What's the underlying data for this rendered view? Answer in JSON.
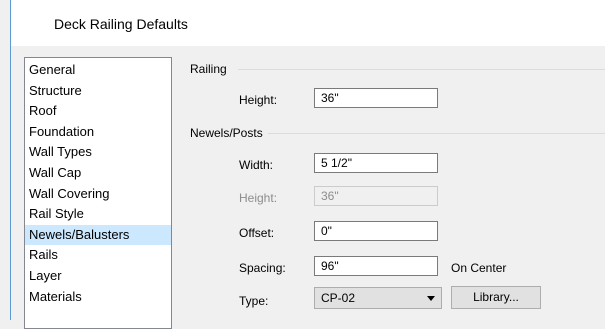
{
  "window": {
    "title": "Deck Railing Defaults"
  },
  "sidebar": {
    "items": [
      {
        "label": "General",
        "selected": false
      },
      {
        "label": "Structure",
        "selected": false
      },
      {
        "label": "Roof",
        "selected": false
      },
      {
        "label": "Foundation",
        "selected": false
      },
      {
        "label": "Wall Types",
        "selected": false
      },
      {
        "label": "Wall Cap",
        "selected": false
      },
      {
        "label": "Wall Covering",
        "selected": false
      },
      {
        "label": "Rail Style",
        "selected": false
      },
      {
        "label": "Newels/Balusters",
        "selected": true
      },
      {
        "label": "Rails",
        "selected": false
      },
      {
        "label": "Layer",
        "selected": false
      },
      {
        "label": "Materials",
        "selected": false
      }
    ],
    "selected_color": "#cce8ff"
  },
  "railing": {
    "group_label": "Railing",
    "height_label": "Height:",
    "height_value": "36\""
  },
  "newels": {
    "group_label": "Newels/Posts",
    "width_label": "Width:",
    "width_value": "5 1/2\"",
    "height_label": "Height:",
    "height_value": "36\"",
    "height_disabled": true,
    "offset_label": "Offset:",
    "offset_value": "0\"",
    "spacing_label": "Spacing:",
    "spacing_value": "96\"",
    "spacing_suffix": "On Center",
    "type_label": "Type:",
    "type_value": "CP-02",
    "library_button": "Library..."
  }
}
